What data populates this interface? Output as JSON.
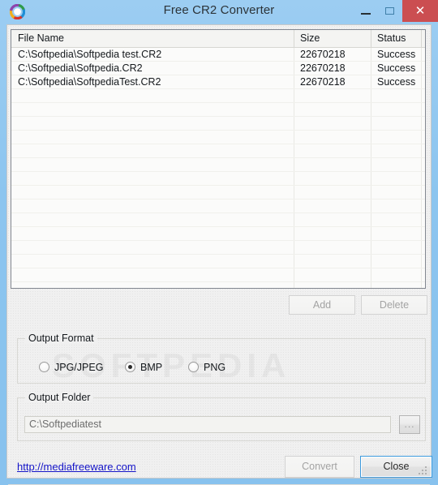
{
  "window": {
    "title": "Free CR2 Converter",
    "icon": "color-wheel-icon",
    "controls": {
      "minimize": "–",
      "maximize": "□",
      "close": "✕"
    },
    "colors": {
      "frame": "#8ec6f0",
      "client": "#f0f0f0",
      "close_button": "#cb4e51",
      "link": "#1414c8",
      "focus": "#3c99dc"
    }
  },
  "file_list": {
    "columns": [
      "File Name",
      "Size",
      "Status",
      ""
    ],
    "rows": [
      {
        "name": "C:\\Softpedia\\Softpedia test.CR2",
        "size": "22670218",
        "status": "Success",
        "extra": ""
      },
      {
        "name": "C:\\Softpedia\\Softpedia.CR2",
        "size": "22670218",
        "status": "Success",
        "extra": ""
      },
      {
        "name": "C:\\Softpedia\\SoftpediaTest.CR2",
        "size": "22670218",
        "status": "Success",
        "extra": ""
      }
    ]
  },
  "list_buttons": {
    "add_label": "Add",
    "delete_label": "Delete"
  },
  "output_format": {
    "group_title": "Output Format",
    "selected": "BMP",
    "options": [
      {
        "label": "JPG/JPEG",
        "checked": false
      },
      {
        "label": "BMP",
        "checked": true
      },
      {
        "label": "PNG",
        "checked": false
      }
    ]
  },
  "output_folder": {
    "group_title": "Output Folder",
    "value": "C:\\Softpediatest",
    "placeholder": "C:\\Softpediatest",
    "browse_label": "..."
  },
  "footer": {
    "link_text": "http://mediafreeware.com",
    "convert_label": "Convert",
    "close_label": "Close"
  },
  "watermark": {
    "text": "SOFTPEDIA"
  }
}
